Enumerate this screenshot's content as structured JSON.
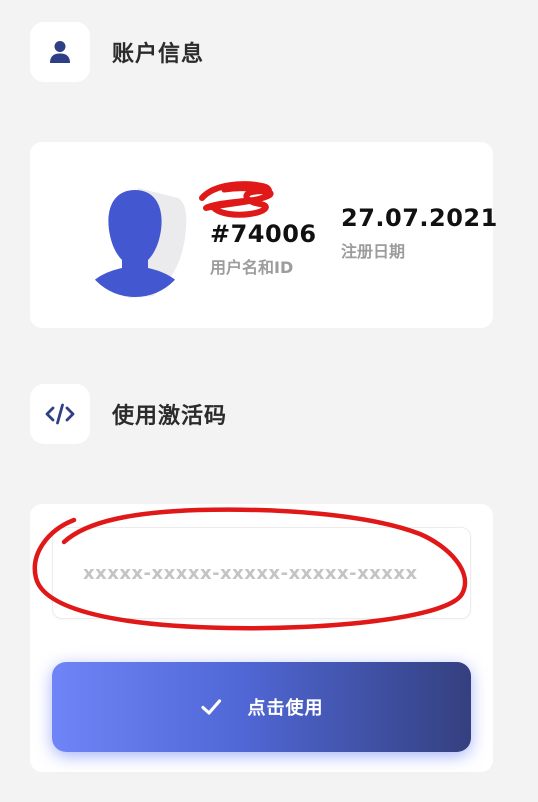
{
  "account_section": {
    "title": "账户信息",
    "icon": "user-icon"
  },
  "account_card": {
    "user_id": "#74006",
    "user_label": "用户名和ID",
    "registration_date": "27.07.2021",
    "registration_label": "注册日期",
    "avatar_icon": "user-avatar-silhouette"
  },
  "activation_section": {
    "title": "使用激活码",
    "icon": "code-icon"
  },
  "activation_card": {
    "code_placeholder": "xxxxx-xxxxx-xxxxx-xxxxx-xxxxx",
    "code_value": "",
    "apply_label": "点击使用",
    "apply_icon": "check-icon"
  },
  "colors": {
    "accent": "#5f76f5",
    "accent_dark": "#34407f",
    "icon_color": "#2f3f86",
    "annotation_red": "#e01818",
    "background": "#f3f3f3"
  }
}
